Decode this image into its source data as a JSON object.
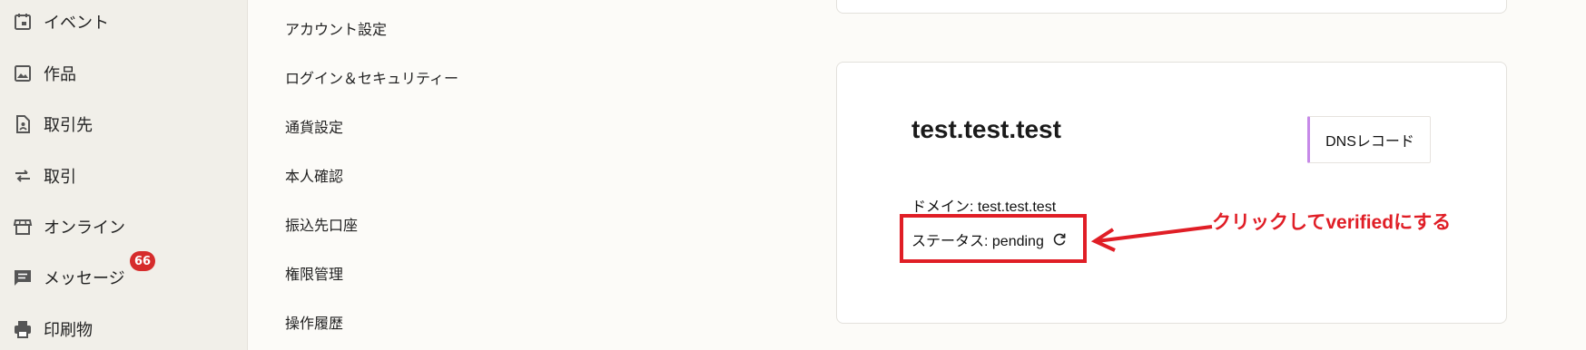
{
  "sidebar": {
    "items": [
      {
        "label": "イベント",
        "icon": "calendar-icon"
      },
      {
        "label": "作品",
        "icon": "image-icon"
      },
      {
        "label": "取引先",
        "icon": "contact-file-icon"
      },
      {
        "label": "取引",
        "icon": "swap-arrows-icon"
      },
      {
        "label": "オンライン",
        "icon": "storefront-icon"
      },
      {
        "label": "メッセージ",
        "icon": "message-icon",
        "badge": "66"
      },
      {
        "label": "印刷物",
        "icon": "printer-icon"
      }
    ]
  },
  "settings_menu": {
    "items": [
      "アカウント設定",
      "ログイン＆セキュリティー",
      "通貨設定",
      "本人確認",
      "振込先口座",
      "権限管理",
      "操作履歴"
    ]
  },
  "domain_card": {
    "title": "test.test.test",
    "dns_button_label": "DNSレコード",
    "domain_line": "ドメイン: test.test.test",
    "status_line": "ステータス: pending"
  },
  "annotation": {
    "text": "クリックしてverifiedにする",
    "color": "#e01e26"
  },
  "colors": {
    "badge": "#d62c2c",
    "button_accent": "#c689e8",
    "sidebar_bg": "#f1efe9"
  }
}
